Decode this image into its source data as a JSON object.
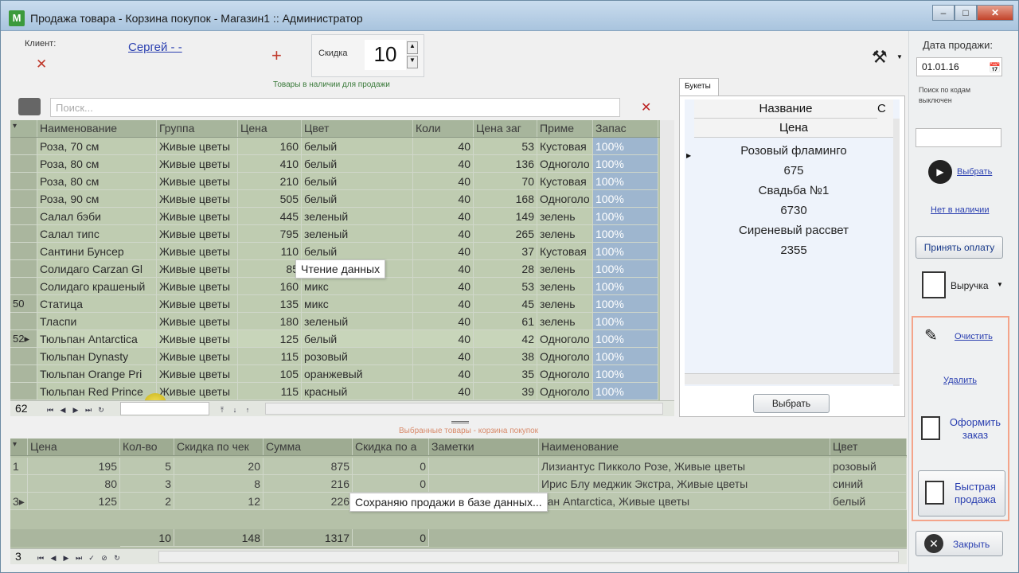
{
  "window": {
    "title": "Продажа товара - Корзина покупок - Магазин1 :: Администратор"
  },
  "client": {
    "label": "Клиент:",
    "name": "Сергей - -"
  },
  "discount": {
    "label": "Скидка",
    "value": "10"
  },
  "sale_date": {
    "label": "Дата продажи:",
    "value": "01.01.16"
  },
  "code_search": {
    "label": "Поиск по кодам выключен",
    "value": ""
  },
  "products_caption": "Товары в наличии для продажи",
  "search": {
    "placeholder": "Поиск..."
  },
  "products": {
    "columns": [
      "Наименование",
      "Группа",
      "Цена",
      "Цвет",
      "Коли",
      "Цена заг",
      "Приме",
      "Запас"
    ],
    "rows": [
      {
        "marker": "",
        "name": "Роза, 70 см",
        "group": "Живые цветы",
        "price": "160",
        "color": "белый",
        "qty": "40",
        "cost": "53",
        "note": "Кустовая",
        "stock": "100%"
      },
      {
        "marker": "",
        "name": "Роза, 80 см",
        "group": "Живые цветы",
        "price": "410",
        "color": "белый",
        "qty": "40",
        "cost": "136",
        "note": "Одноголо",
        "stock": "100%"
      },
      {
        "marker": "",
        "name": "Роза, 80 см",
        "group": "Живые цветы",
        "price": "210",
        "color": "белый",
        "qty": "40",
        "cost": "70",
        "note": "Кустовая",
        "stock": "100%"
      },
      {
        "marker": "",
        "name": "Роза, 90 см",
        "group": "Живые цветы",
        "price": "505",
        "color": "белый",
        "qty": "40",
        "cost": "168",
        "note": "Одноголо",
        "stock": "100%"
      },
      {
        "marker": "",
        "name": "Салал бэби",
        "group": "Живые цветы",
        "price": "445",
        "color": "зеленый",
        "qty": "40",
        "cost": "149",
        "note": "зелень",
        "stock": "100%"
      },
      {
        "marker": "",
        "name": "Салал типс",
        "group": "Живые цветы",
        "price": "795",
        "color": "зеленый",
        "qty": "40",
        "cost": "265",
        "note": "зелень",
        "stock": "100%"
      },
      {
        "marker": "",
        "name": "Сантини Бунсер",
        "group": "Живые цветы",
        "price": "110",
        "color": "белый",
        "qty": "40",
        "cost": "37",
        "note": "Кустовая",
        "stock": "100%"
      },
      {
        "marker": "",
        "name": "Солидаго Carzan Gl",
        "group": "Живые цветы",
        "price": "85",
        "color": "",
        "qty": "40",
        "cost": "28",
        "note": "зелень",
        "stock": "100%"
      },
      {
        "marker": "",
        "name": "Солидаго крашеный",
        "group": "Живые цветы",
        "price": "160",
        "color": "микс",
        "qty": "40",
        "cost": "53",
        "note": "зелень",
        "stock": "100%"
      },
      {
        "marker": "50",
        "name": "Статица",
        "group": "Живые цветы",
        "price": "135",
        "color": "микс",
        "qty": "40",
        "cost": "45",
        "note": "зелень",
        "stock": "100%"
      },
      {
        "marker": "",
        "name": "Тласпи",
        "group": "Живые цветы",
        "price": "180",
        "color": "зеленый",
        "qty": "40",
        "cost": "61",
        "note": "зелень",
        "stock": "100%"
      },
      {
        "marker": "52▸",
        "name": "Тюльпан Antarctica",
        "group": "Живые цветы",
        "price": "125",
        "color": "белый",
        "qty": "40",
        "cost": "42",
        "note": "Одноголо",
        "stock": "100%"
      },
      {
        "marker": "",
        "name": "Тюльпан Dynasty",
        "group": "Живые цветы",
        "price": "115",
        "color": "розовый",
        "qty": "40",
        "cost": "38",
        "note": "Одноголо",
        "stock": "100%"
      },
      {
        "marker": "",
        "name": "Тюльпан Orange Pri",
        "group": "Живые цветы",
        "price": "105",
        "color": "оранжевый",
        "qty": "40",
        "cost": "35",
        "note": "Одноголо",
        "stock": "100%"
      },
      {
        "marker": "",
        "name": "Тюльпан Red Prince",
        "group": "Живые цветы",
        "price": "115",
        "color": "красный",
        "qty": "40",
        "cost": "39",
        "note": "Одноголо",
        "stock": "100%"
      }
    ],
    "count": "62"
  },
  "tooltip_read": "Чтение данных",
  "bouquets": {
    "tab": "Букеты",
    "col_name": "Название",
    "col_extra": "С",
    "col_price": "Цена",
    "items": [
      {
        "name": "Розовый фламинго",
        "price": "675"
      },
      {
        "name": "Свадьба №1",
        "price": "6730"
      },
      {
        "name": "Сиреневый рассвет",
        "price": "2355"
      }
    ],
    "select_button": "Выбрать"
  },
  "cart_caption": "Выбранные товары - корзина покупок",
  "cart": {
    "columns": [
      "Цена",
      "Кол-во",
      "Скидка по чек",
      "Сумма",
      "Скидка по а",
      "Заметки",
      "Наименование",
      "Цвет"
    ],
    "rows": [
      {
        "marker": "1",
        "price": "195",
        "qty": "5",
        "disc": "20",
        "sum": "875",
        "disc2": "0",
        "notes": "",
        "name": "Лизиантус Пикколо Розе, Живые цветы",
        "color": "розовый"
      },
      {
        "marker": "",
        "price": "80",
        "qty": "3",
        "disc": "8",
        "sum": "216",
        "disc2": "0",
        "notes": "",
        "name": "Ирис Блу меджик Экстра, Живые цветы",
        "color": "синий"
      },
      {
        "marker": "3▸",
        "price": "125",
        "qty": "2",
        "disc": "12",
        "sum": "226",
        "disc2": "",
        "notes": "",
        "name": "пан Antarctica, Живые цветы",
        "color": "белый"
      }
    ],
    "totals": {
      "qty": "10",
      "disc": "148",
      "sum": "1317",
      "disc2": "0"
    },
    "count": "3"
  },
  "tooltip_save": "Сохраняю продажи в базе данных...",
  "right": {
    "select": "Выбрать",
    "not_in_stock": "Нет в наличии",
    "accept_payment": "Принять оплату",
    "revenue": "Выручка",
    "clear": "Очистить",
    "delete": "Удалить",
    "place_order": "Оформить заказ",
    "quick_sale": "Быстрая продажа",
    "close": "Закрыть"
  },
  "colors": {
    "grid_row": "#bfccb1",
    "grid_head": "#a7b59c",
    "stock": "#9eb6cf",
    "accent": "#2a3fb0",
    "cart_bg": "#b5c1a8"
  }
}
